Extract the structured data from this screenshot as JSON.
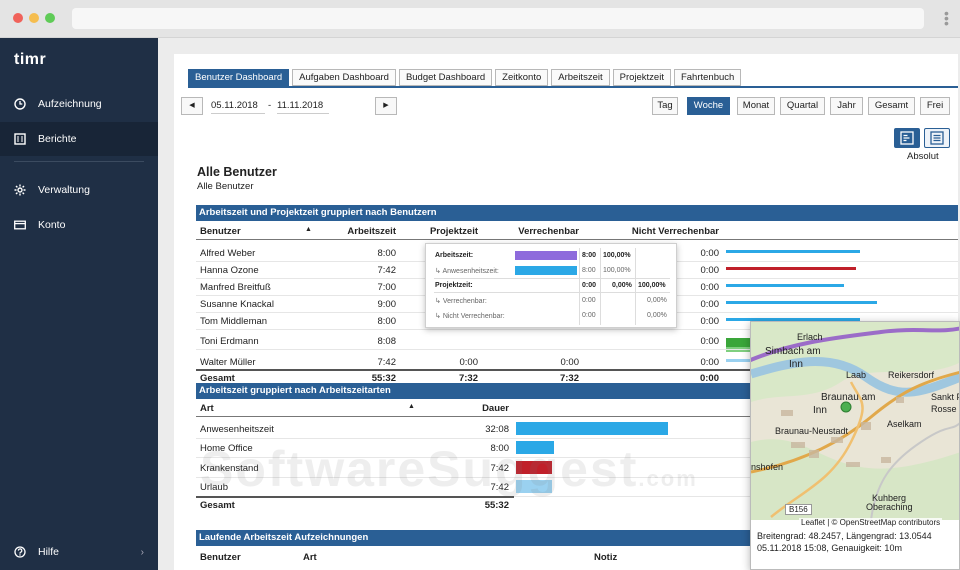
{
  "sidebar": {
    "logo": "timr",
    "items": [
      {
        "label": "Aufzeichnung"
      },
      {
        "label": "Berichte"
      },
      {
        "label": "Verwaltung"
      },
      {
        "label": "Konto"
      }
    ],
    "help": "Hilfe"
  },
  "tabs": [
    "Benutzer Dashboard",
    "Aufgaben Dashboard",
    "Budget Dashboard",
    "Zeitkonto",
    "Arbeitszeit",
    "Projektzeit",
    "Fahrtenbuch"
  ],
  "toolbar": {
    "prev": "◀",
    "next": "▶",
    "date_from": "05.11.2018",
    "date_sep": "-",
    "date_to": "11.11.2018",
    "ranges": [
      "Tag",
      "Woche",
      "Monat",
      "Quartal",
      "Jahr",
      "Gesamt",
      "Frei"
    ],
    "active_range": "Woche",
    "view_label": "Absolut"
  },
  "header": {
    "title": "Alle Benutzer",
    "subtitle": "Alle Benutzer"
  },
  "section1": {
    "title": "Arbeitszeit und Projektzeit gruppiert nach Benutzern",
    "columns": [
      "Benutzer",
      "Arbeitszeit",
      "Projektzeit",
      "Verrechenbar",
      "Nicht Verrechenbar"
    ],
    "rows": [
      {
        "name": "Alfred Weber",
        "arbeitszeit": "8:00",
        "projektzeit": "0:00",
        "verrechenbar": "0:00",
        "nicht": "0:00"
      },
      {
        "name": "Hanna Ozone",
        "arbeitszeit": "7:42",
        "projektzeit": "",
        "verrechenbar": "",
        "nicht": "0:00"
      },
      {
        "name": "Manfred Breitfuß",
        "arbeitszeit": "7:00",
        "projektzeit": "",
        "verrechenbar": "",
        "nicht": "0:00"
      },
      {
        "name": "Susanne Knackal",
        "arbeitszeit": "9:00",
        "projektzeit": "",
        "verrechenbar": "",
        "nicht": "0:00"
      },
      {
        "name": "Tom Middleman",
        "arbeitszeit": "8:00",
        "projektzeit": "",
        "verrechenbar": "",
        "nicht": "0:00"
      },
      {
        "name": "Toni Erdmann",
        "arbeitszeit": "8:08",
        "projektzeit": "",
        "verrechenbar": "",
        "nicht": "0:00"
      },
      {
        "name": "Walter Müller",
        "arbeitszeit": "7:42",
        "projektzeit": "0:00",
        "verrechenbar": "0:00",
        "nicht": "0:00"
      }
    ],
    "total": {
      "label": "Gesamt",
      "arbeitszeit": "55:32",
      "projektzeit": "7:32",
      "verrechenbar": "7:32",
      "nicht": "0:00"
    }
  },
  "tooltip": {
    "rows": [
      {
        "label": "Arbeitszeit:",
        "value": "8:00",
        "pct1": "100,00%",
        "pct2": ""
      },
      {
        "label": "Anwesenheitszeit:",
        "value": "8:00",
        "pct1": "100,00%",
        "pct2": ""
      },
      {
        "label": "Projektzeit:",
        "value": "0:00",
        "pct1": "0,00%",
        "pct2": "100,00%"
      },
      {
        "label": "Verrechenbar:",
        "value": "0:00",
        "pct1": "",
        "pct2": "0,00%"
      },
      {
        "label": "Nicht Verrechenbar:",
        "value": "0:00",
        "pct1": "",
        "pct2": "0,00%"
      }
    ]
  },
  "section2": {
    "title": "Arbeitszeit gruppiert nach Arbeitszeitarten",
    "columns": [
      "Art",
      "Dauer"
    ],
    "rows": [
      {
        "name": "Anwesenheitszeit",
        "value": "32:08",
        "hours": 32.13,
        "color": "#2ba8e6"
      },
      {
        "name": "Home Office",
        "value": "8:00",
        "hours": 8.0,
        "color": "#2ba8e6"
      },
      {
        "name": "Krankenstand",
        "value": "7:42",
        "hours": 7.7,
        "color": "#c0202a"
      },
      {
        "name": "Urlaub",
        "value": "7:42",
        "hours": 7.7,
        "color": "#9ad1f0"
      }
    ],
    "total": {
      "label": "Gesamt",
      "value": "55:32"
    }
  },
  "section3": {
    "title": "Laufende Arbeitszeit Aufzeichnungen",
    "columns": [
      "Benutzer",
      "Art",
      "Notiz"
    ]
  },
  "map": {
    "places": [
      "Erlach",
      "Simbach am",
      "Inn",
      "Laab",
      "Reikersdorf",
      "Braunau am",
      "Inn",
      "Braunau-Neustadt",
      "Sankt F",
      "Rosse",
      "Aselkam",
      "nshofen",
      "Oberaching",
      "Kuhberg",
      "B156"
    ],
    "attribution": "Leaflet | © OpenStreetMap contributors",
    "coords": "Breitengrad: 48.2457, Längengrad: 13.0544",
    "timestamp": "05.11.2018 15:08, Genauigkeit: 10m"
  },
  "watermark": {
    "main": "SoftwareSuggest",
    "suffix": ".com"
  },
  "colors": {
    "brand": "#2a5f95",
    "sidebar": "#1f2f45",
    "bar_blue": "#2ba8e6",
    "bar_red": "#c0202a",
    "bar_green": "#3aa63a",
    "bar_purple": "#8e6bdc"
  }
}
